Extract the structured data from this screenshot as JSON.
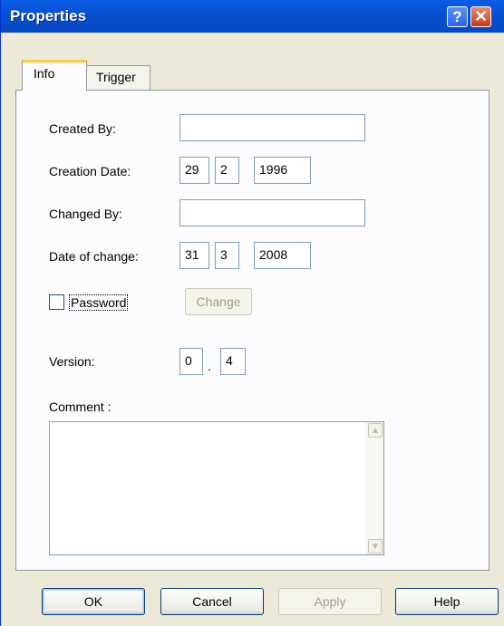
{
  "window": {
    "title": "Properties",
    "help_label": "?",
    "close_label": "✕"
  },
  "tabs": [
    {
      "label": "Info",
      "selected": true
    },
    {
      "label": "Trigger",
      "selected": false
    }
  ],
  "info": {
    "created_by": {
      "label": "Created By:",
      "value": ""
    },
    "creation_date": {
      "label": "Creation Date:",
      "day": "29",
      "month": "2",
      "year": "1996"
    },
    "changed_by": {
      "label": "Changed By:",
      "value": ""
    },
    "date_of_change": {
      "label": "Date of change:",
      "day": "31",
      "month": "3",
      "year": "2008"
    },
    "password": {
      "label": "Password",
      "checked": false,
      "change_label": "Change"
    },
    "version": {
      "label": "Version:",
      "major": "0",
      "separator": ".",
      "minor": "4"
    },
    "comment": {
      "label": "Comment :",
      "value": ""
    }
  },
  "buttons": {
    "ok": "OK",
    "cancel": "Cancel",
    "apply": "Apply",
    "help": "Help"
  },
  "icons": {
    "scroll_up": "scroll-up-arrow-icon",
    "scroll_down": "scroll-down-arrow-icon"
  },
  "colors": {
    "titlebar": "#0A5DE6",
    "face": "#ECE9D8",
    "tab_accent": "#FFC83C",
    "close": "#C7391B"
  }
}
